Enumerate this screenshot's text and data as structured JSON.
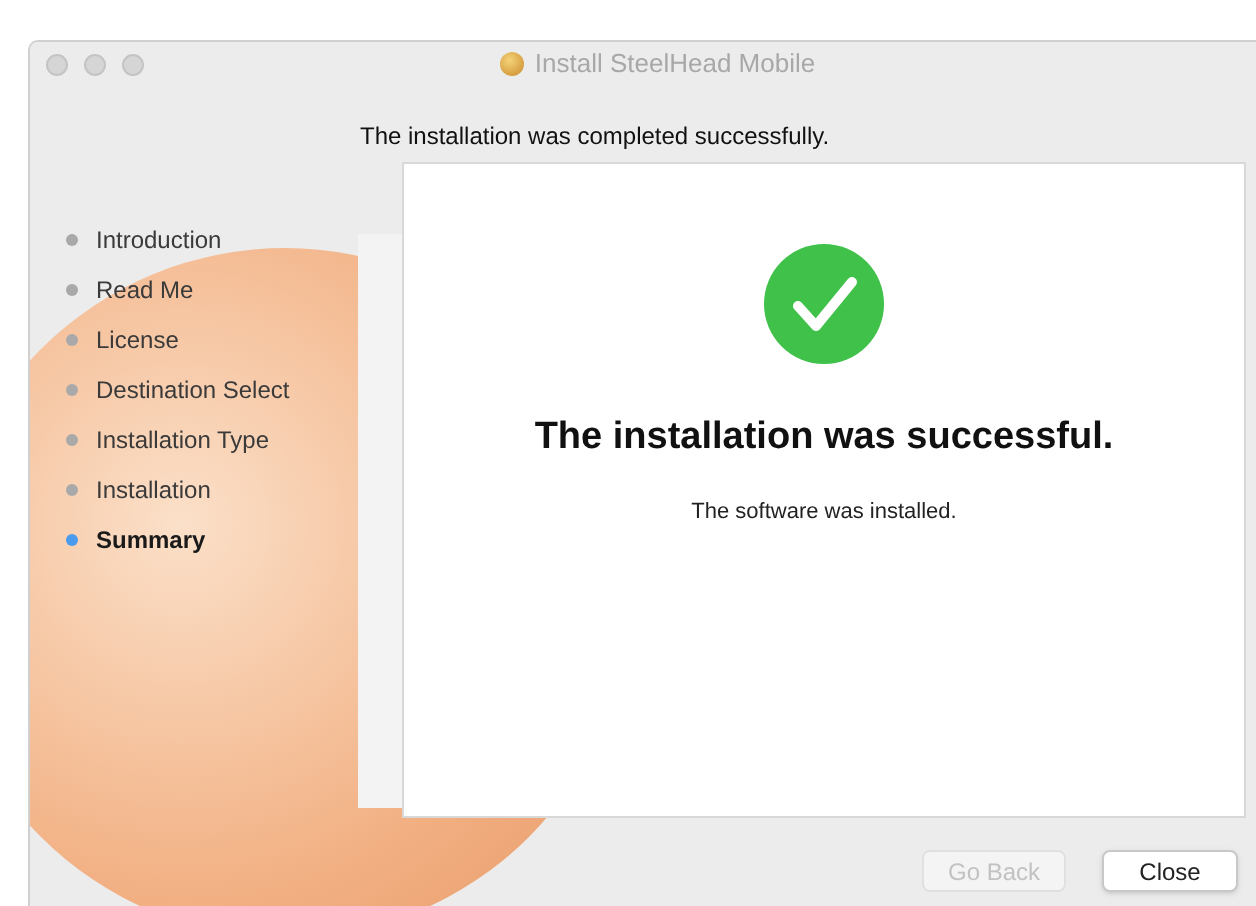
{
  "window": {
    "title": "Install SteelHead Mobile"
  },
  "header": "The installation was completed successfully.",
  "sidebar": {
    "items": [
      {
        "label": "Introduction",
        "selected": false
      },
      {
        "label": "Read Me",
        "selected": false
      },
      {
        "label": "License",
        "selected": false
      },
      {
        "label": "Destination Select",
        "selected": false
      },
      {
        "label": "Installation Type",
        "selected": false
      },
      {
        "label": "Installation",
        "selected": false
      },
      {
        "label": "Summary",
        "selected": true
      }
    ]
  },
  "content": {
    "heading": "The installation was successful.",
    "message": "The software was installed."
  },
  "buttons": [
    {
      "label": "Go Back",
      "disabled": true
    },
    {
      "label": "Close",
      "disabled": false
    }
  ]
}
